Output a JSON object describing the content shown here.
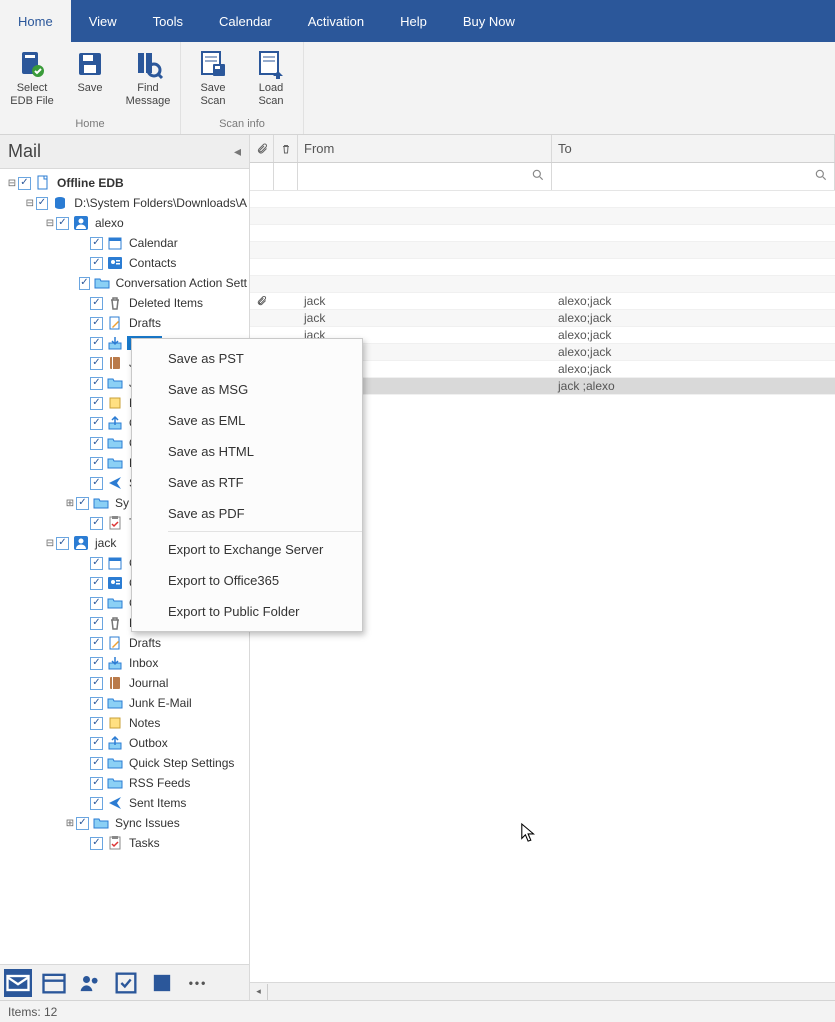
{
  "menu": {
    "items": [
      "Home",
      "View",
      "Tools",
      "Calendar",
      "Activation",
      "Help",
      "Buy Now"
    ],
    "active_index": 0
  },
  "ribbon": {
    "groups": [
      {
        "label": "Home",
        "buttons": [
          {
            "label": "Select EDB File",
            "icon": "file-open"
          },
          {
            "label": "Save",
            "icon": "save"
          },
          {
            "label": "Find Message",
            "icon": "find"
          }
        ]
      },
      {
        "label": "Scan info",
        "buttons": [
          {
            "label": "Save Scan",
            "icon": "save-scan"
          },
          {
            "label": "Load Scan",
            "icon": "load-scan"
          }
        ]
      }
    ]
  },
  "mail_header": "Mail",
  "tree": [
    {
      "d": 0,
      "tw": "-",
      "bold": true,
      "icon": "page",
      "label": "Offline EDB"
    },
    {
      "d": 1,
      "tw": "-",
      "icon": "db",
      "label": "D:\\System Folders\\Downloads\\A"
    },
    {
      "d": 2,
      "tw": "-",
      "icon": "user",
      "label": "alexo"
    },
    {
      "d": 3,
      "icon": "calendar",
      "label": "Calendar"
    },
    {
      "d": 3,
      "icon": "contact",
      "label": "Contacts"
    },
    {
      "d": 3,
      "icon": "folder",
      "label": "Conversation Action Sett"
    },
    {
      "d": 3,
      "icon": "trash",
      "label": "Deleted Items"
    },
    {
      "d": 3,
      "icon": "draft",
      "label": "Drafts"
    },
    {
      "d": 3,
      "icon": "inbox",
      "label": "Inbox",
      "sel": true
    },
    {
      "d": 3,
      "icon": "journal",
      "label": "Jou"
    },
    {
      "d": 3,
      "icon": "folder",
      "label": "Jun"
    },
    {
      "d": 3,
      "icon": "note",
      "label": "No"
    },
    {
      "d": 3,
      "icon": "outbox",
      "label": "Ou"
    },
    {
      "d": 3,
      "icon": "folder",
      "label": "Qu"
    },
    {
      "d": 3,
      "icon": "folder",
      "label": "RS"
    },
    {
      "d": 3,
      "icon": "sent",
      "label": "Se"
    },
    {
      "d": 3,
      "tw": "+",
      "tw_shift": true,
      "icon": "folder",
      "label": "Sy"
    },
    {
      "d": 3,
      "icon": "task",
      "label": "Ta"
    },
    {
      "d": 2,
      "tw": "-",
      "icon": "user",
      "label": "jack"
    },
    {
      "d": 3,
      "icon": "calendar",
      "label": "Ca"
    },
    {
      "d": 3,
      "icon": "contact",
      "label": "Co"
    },
    {
      "d": 3,
      "icon": "folder",
      "label": "Co"
    },
    {
      "d": 3,
      "icon": "trash",
      "label": "Deleted Items"
    },
    {
      "d": 3,
      "icon": "draft",
      "label": "Drafts"
    },
    {
      "d": 3,
      "icon": "inbox",
      "label": "Inbox"
    },
    {
      "d": 3,
      "icon": "journal",
      "label": "Journal"
    },
    {
      "d": 3,
      "icon": "folder",
      "label": "Junk E-Mail"
    },
    {
      "d": 3,
      "icon": "note",
      "label": "Notes"
    },
    {
      "d": 3,
      "icon": "outbox",
      "label": "Outbox"
    },
    {
      "d": 3,
      "icon": "folder",
      "label": "Quick Step Settings"
    },
    {
      "d": 3,
      "icon": "folder",
      "label": "RSS Feeds"
    },
    {
      "d": 3,
      "icon": "sent",
      "label": "Sent Items"
    },
    {
      "d": 3,
      "tw": "+",
      "tw_shift": true,
      "icon": "folder",
      "label": "Sync Issues"
    },
    {
      "d": 3,
      "icon": "task",
      "label": "Tasks"
    }
  ],
  "columns": {
    "from": "From",
    "to": "To",
    "search_placeholder": ""
  },
  "rows": [
    {
      "att": false,
      "from": "",
      "to": ""
    },
    {
      "att": false,
      "from": "",
      "to": ""
    },
    {
      "att": false,
      "from": "",
      "to": ""
    },
    {
      "att": false,
      "from": "",
      "to": ""
    },
    {
      "att": false,
      "from": "",
      "to": ""
    },
    {
      "att": false,
      "from": "",
      "to": ""
    },
    {
      "att": true,
      "from": "jack",
      "to": "alexo;jack"
    },
    {
      "att": false,
      "from": "jack",
      "to": "alexo;jack"
    },
    {
      "att": false,
      "from": "jack",
      "to": "alexo;jack"
    },
    {
      "att": false,
      "from": "jack",
      "to": "alexo;jack"
    },
    {
      "att": false,
      "from": "",
      "to": "alexo;jack"
    },
    {
      "att": false,
      "from": "",
      "to": "jack ;alexo",
      "active": true
    }
  ],
  "context_menu": {
    "items": [
      "Save as PST",
      "Save as MSG",
      "Save as EML",
      "Save as HTML",
      "Save as RTF",
      "Save as PDF",
      "Export to Exchange Server",
      "Export to Office365",
      "Export to Public Folder"
    ],
    "sep_after": [
      5
    ]
  },
  "status": "Items: 12"
}
